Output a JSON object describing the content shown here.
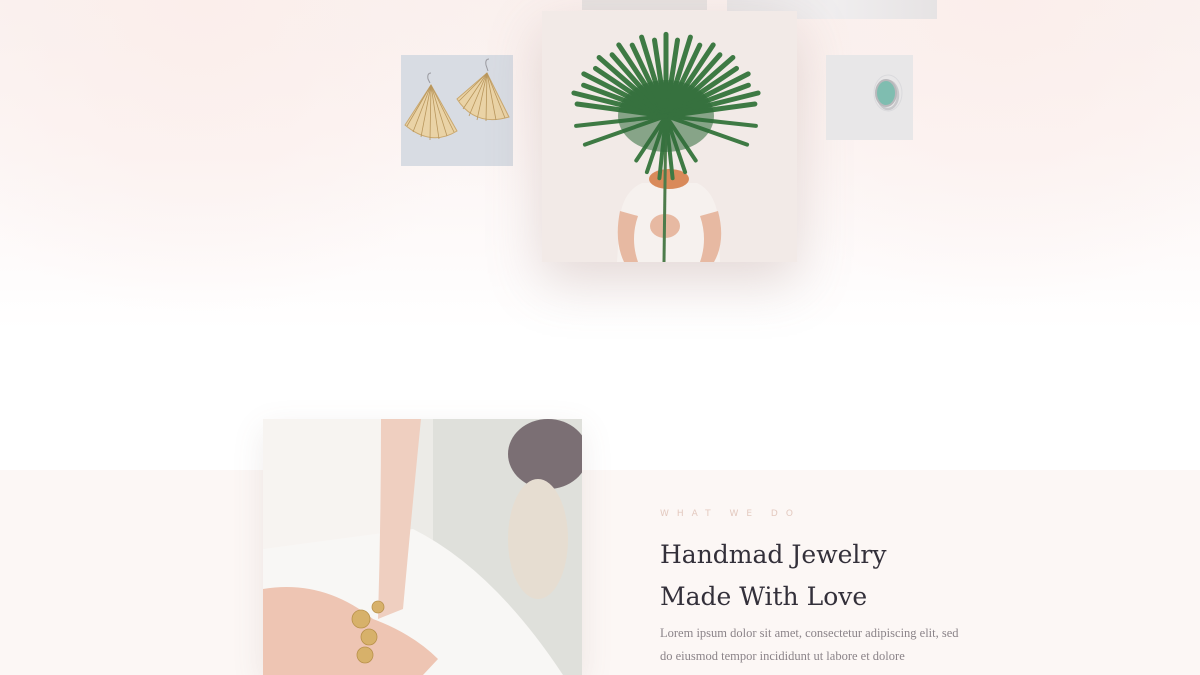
{
  "gallery": {
    "images": [
      {
        "name": "earrings-image",
        "alt": "Gold fan-shaped earrings"
      },
      {
        "name": "featured-image",
        "alt": "Woman holding a palm leaf"
      },
      {
        "name": "ring-image",
        "alt": "Ring with green stone"
      }
    ]
  },
  "about": {
    "photo_alt": "Woman wearing gold coin bracelet",
    "eyebrow": "WHAT WE DO",
    "headline": "Handmad Jewelry Made With Love",
    "body": "Lorem ipsum dolor sit amet, consectetur adipiscing elit, sed do eiusmod tempor incididunt ut labore et dolore"
  },
  "colors": {
    "accent": "#e3c9bf",
    "heading": "#33303a",
    "body_text": "#8b8489",
    "section_bg": "#fcf7f5"
  }
}
